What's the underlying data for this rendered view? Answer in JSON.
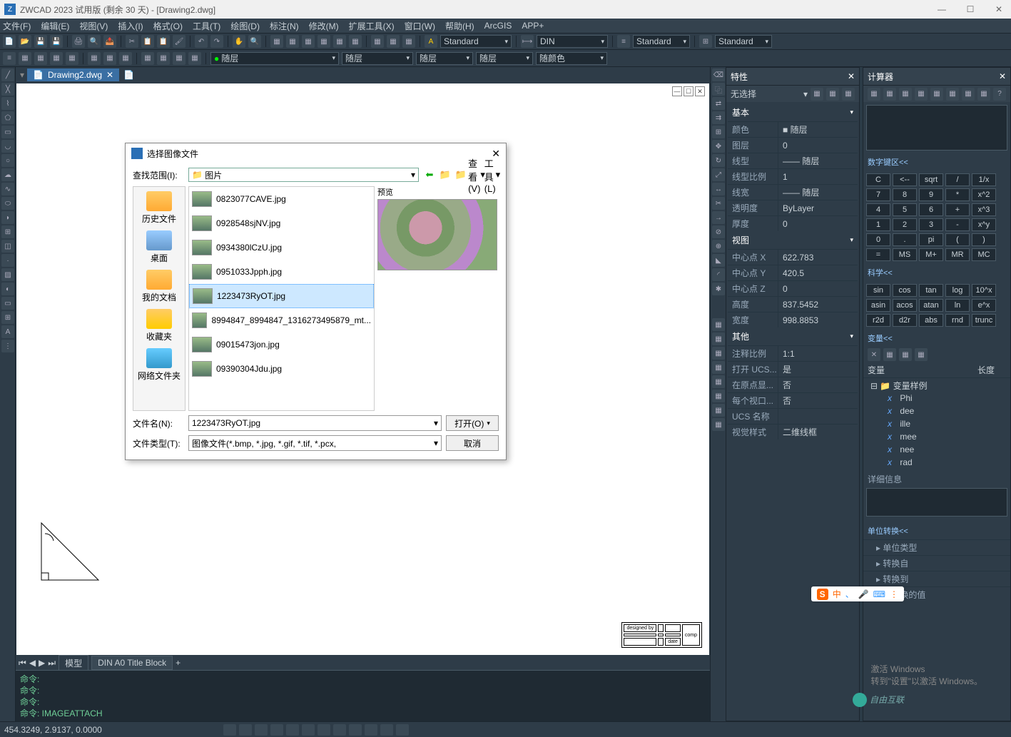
{
  "title": "ZWCAD 2023 试用版 (剩余 30 天) - [Drawing2.dwg]",
  "menus": [
    "文件(F)",
    "编辑(E)",
    "视图(V)",
    "插入(I)",
    "格式(O)",
    "工具(T)",
    "绘图(D)",
    "标注(N)",
    "修改(M)",
    "扩展工具(X)",
    "窗口(W)",
    "帮助(H)",
    "ArcGIS",
    "APP+"
  ],
  "styles": {
    "text": "Standard",
    "dim": "DIN",
    "mls": "Standard",
    "ts": "Standard"
  },
  "layerbar": {
    "layer": "随层",
    "c1": "随层",
    "c2": "随层",
    "c3": "随层",
    "c4": "随颜色"
  },
  "doctab": "Drawing2.dwg",
  "modeltabs": {
    "model": "模型",
    "layout": "DIN A0 Title Block"
  },
  "cmd": {
    "l1": "命令:",
    "l2": "命令:",
    "l3": "命令:",
    "l4": "命令: IMAGEATTACH"
  },
  "status_coords": "454.3249, 2.9137, 0.0000",
  "dialog": {
    "title": "选择图像文件",
    "lookin_lbl": "查找范围(I):",
    "lookin_val": "图片",
    "view_btn": "查看(V)",
    "tools_btn": "工具(L)",
    "places": [
      "历史文件",
      "桌面",
      "我的文档",
      "收藏夹",
      "网络文件夹"
    ],
    "files": [
      "0823077CAVE.jpg",
      "0928548sjNV.jpg",
      "0934380lCzU.jpg",
      "0951033Jpph.jpg",
      "1223473RyOT.jpg",
      "8994847_8994847_1316273495879_mt...",
      "09015473jon.jpg",
      "09390304Jdu.jpg"
    ],
    "selected_idx": 4,
    "preview_lbl": "预览",
    "fname_lbl": "文件名(N):",
    "fname_val": "1223473RyOT.jpg",
    "ftype_lbl": "文件类型(T):",
    "ftype_val": "图像文件(*.bmp, *.jpg, *.gif, *.tif, *.pcx, ",
    "open": "打开(O)",
    "cancel": "取消"
  },
  "props": {
    "panel_title": "特性",
    "no_sel": "无选择",
    "sec_basic": "基本",
    "rows_basic": [
      [
        "颜色",
        "■ 随层"
      ],
      [
        "图层",
        "0"
      ],
      [
        "线型",
        "—— 随层"
      ],
      [
        "线型比例",
        "1"
      ],
      [
        "线宽",
        "—— 随层"
      ],
      [
        "透明度",
        "ByLayer"
      ],
      [
        "厚度",
        "0"
      ]
    ],
    "sec_view": "视图",
    "rows_view": [
      [
        "中心点 X",
        "622.783"
      ],
      [
        "中心点 Y",
        "420.5"
      ],
      [
        "中心点 Z",
        "0"
      ],
      [
        "高度",
        "837.5452"
      ],
      [
        "宽度",
        "998.8853"
      ]
    ],
    "sec_other": "其他",
    "rows_other": [
      [
        "注释比例",
        "1:1"
      ],
      [
        "打开 UCS...",
        "是"
      ],
      [
        "在原点显...",
        "否"
      ],
      [
        "每个视口...",
        "否"
      ],
      [
        "UCS 名称",
        ""
      ],
      [
        "视觉样式",
        "二维线框"
      ]
    ]
  },
  "calc": {
    "panel_title": "计算器",
    "sec_num": "数字键区<<",
    "keys_num": [
      [
        "C",
        "<--",
        "sqrt",
        "/",
        "1/x"
      ],
      [
        "7",
        "8",
        "9",
        "*",
        "x^2"
      ],
      [
        "4",
        "5",
        "6",
        "+",
        "x^3"
      ],
      [
        "1",
        "2",
        "3",
        "-",
        "x^y"
      ],
      [
        "0",
        ".",
        "pi",
        "(",
        ")"
      ],
      [
        "=",
        "MS",
        "M+",
        "MR",
        "MC"
      ]
    ],
    "sec_sci": "科学<<",
    "keys_sci": [
      [
        "sin",
        "cos",
        "tan",
        "log",
        "10^x"
      ],
      [
        "asin",
        "acos",
        "atan",
        "ln",
        "e^x"
      ],
      [
        "r2d",
        "d2r",
        "abs",
        "rnd",
        "trunc"
      ]
    ],
    "sec_var": "变量<<",
    "var_hdr": {
      "a": "变量",
      "b": "长度"
    },
    "var_grp": "变量样例",
    "vars": [
      "Phi",
      "dee",
      "ille",
      "mee",
      "nee",
      "rad"
    ],
    "detail": "详细信息",
    "sec_unit": "单位转换<<",
    "unit_rows": [
      "单位类型",
      "转换自",
      "转换到",
      "要转换的值"
    ]
  },
  "watermark": {
    "l1": "激活 Windows",
    "l2": "转到\"设置\"以激活 Windows。"
  },
  "ime": "中",
  "brand": "自由互联",
  "titleblock": {
    "a": "designed by",
    "b": "date"
  }
}
